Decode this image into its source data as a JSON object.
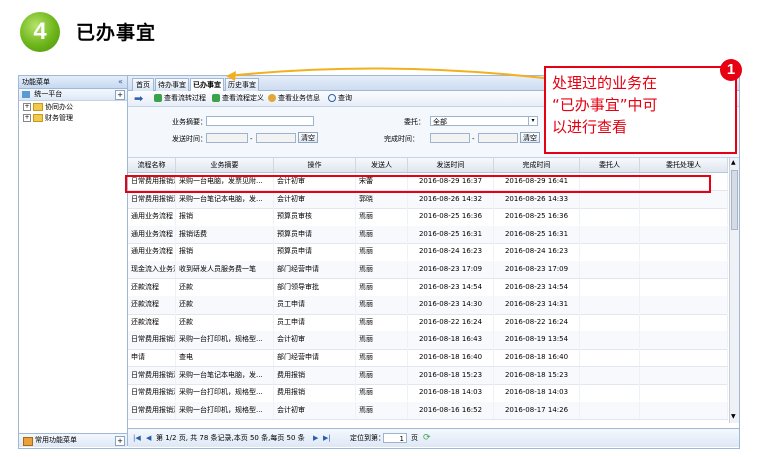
{
  "step": {
    "number": "4",
    "title": "已办事宜"
  },
  "sidebar": {
    "header": "功能菜单",
    "collapse": "«",
    "platform": "统一平台",
    "items": [
      {
        "label": "协同办公"
      },
      {
        "label": "财务管理"
      }
    ],
    "footer": "常用功能菜单"
  },
  "tabs": [
    "首页",
    "待办事宜",
    "已办事宜",
    "历史事宜"
  ],
  "active_tab": "已办事宜",
  "toolbar": {
    "view_flow": "查看流转过程",
    "view_def": "查看流程定义",
    "view_info": "查看业务信息",
    "query": "查询"
  },
  "form": {
    "summary_label": "业务摘要：",
    "send_time_label": "发送时间：",
    "delegate_label": "委托：",
    "delegate_value": "全部",
    "complete_time_label": "完成时间：",
    "dash": "-",
    "clear": "清空"
  },
  "columns": [
    "流程名称",
    "业务摘要",
    "操作",
    "发送人",
    "发送时间",
    "完成时间",
    "委托人",
    "委托处理人"
  ],
  "rows": [
    [
      "日常费用报销流...",
      "采购一台电脑，发票见附...",
      "会计初审",
      "宋蕾",
      "2016-08-29 16:37",
      "2016-08-29 16:41",
      "",
      ""
    ],
    [
      "日常费用报销流...",
      "采购一台笔记本电脑，发...",
      "会计初审",
      "郭晓",
      "2016-08-26 14:32",
      "2016-08-26 14:33",
      "",
      ""
    ],
    [
      "通用业务流程",
      "报销",
      "预算员审核",
      "焉丽",
      "2016-08-25 16:36",
      "2016-08-25 16:36",
      "",
      ""
    ],
    [
      "通用业务流程",
      "报销话费",
      "预算员申请",
      "焉丽",
      "2016-08-25 16:31",
      "2016-08-25 16:31",
      "",
      ""
    ],
    [
      "通用业务流程",
      "报销",
      "预算员申请",
      "焉丽",
      "2016-08-24 16:23",
      "2016-08-24 16:23",
      "",
      ""
    ],
    [
      "现金流入业务流...",
      "收到研发人员服务费一笔",
      "部门经营申请",
      "焉丽",
      "2016-08-23 17:09",
      "2016-08-23 17:09",
      "",
      ""
    ],
    [
      "还款流程",
      "还款",
      "部门领导审批",
      "焉丽",
      "2016-08-23 14:54",
      "2016-08-23 14:54",
      "",
      ""
    ],
    [
      "还款流程",
      "还款",
      "员工申请",
      "焉丽",
      "2016-08-23 14:30",
      "2016-08-23 14:31",
      "",
      ""
    ],
    [
      "还款流程",
      "还款",
      "员工申请",
      "焉丽",
      "2016-08-22 16:24",
      "2016-08-22 16:24",
      "",
      ""
    ],
    [
      "日常费用报销流...",
      "采购一台打印机，规格型...",
      "会计初审",
      "焉丽",
      "2016-08-18 16:43",
      "2016-08-19 13:54",
      "",
      ""
    ],
    [
      "申请",
      "查电",
      "部门经营申请",
      "焉丽",
      "2016-08-18 16:40",
      "2016-08-18 16:40",
      "",
      ""
    ],
    [
      "日常费用报销流...",
      "采购一台笔记本电脑，发...",
      "费用报销",
      "焉丽",
      "2016-08-18 15:23",
      "2016-08-18 15:23",
      "",
      ""
    ],
    [
      "日常费用报销流...",
      "采购一台打印机，规格型...",
      "费用报销",
      "焉丽",
      "2016-08-18 14:03",
      "2016-08-18 14:03",
      "",
      ""
    ],
    [
      "日常费用报销流...",
      "采购一台打印机，规格型...",
      "会计初审",
      "焉丽",
      "2016-08-16 16:52",
      "2016-08-17 14:26",
      "",
      ""
    ]
  ],
  "pager": {
    "text": "第 1/2 页, 共 78 条记录,本页 50 条,每页 50 条",
    "goto_label": "定位到第：",
    "goto_value": "1",
    "page_unit": "页"
  },
  "callout": {
    "number": "1",
    "line1": "处理过的业务在",
    "line2": "“已办事宜”中可",
    "line3": "以进行查看"
  }
}
